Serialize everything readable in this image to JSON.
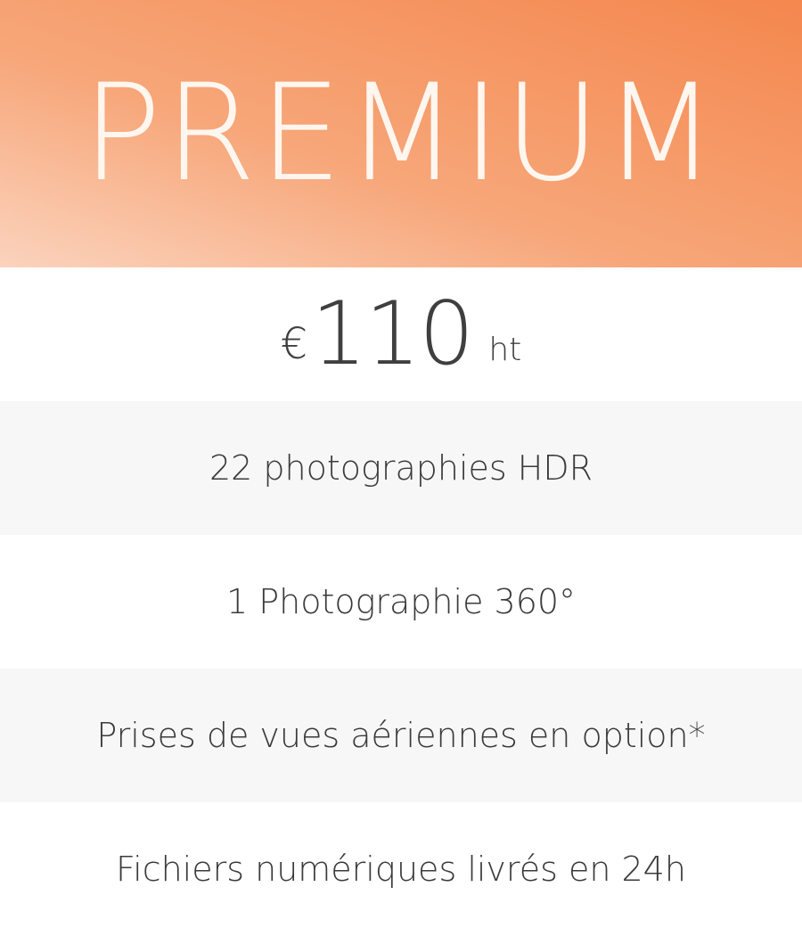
{
  "plan": {
    "title": "PREMIUM",
    "accent_gradient": [
      "#fbd3bd",
      "#f7a77a",
      "#f4874e"
    ],
    "title_color": "#fff7ef"
  },
  "price": {
    "currency": "€",
    "amount": "110",
    "suffix": "ht"
  },
  "features": [
    {
      "label": "22 photographies HDR"
    },
    {
      "label": "1 Photographie 360°"
    },
    {
      "label": "Prises de vues aériennes en option*"
    },
    {
      "label": "Fichiers numériques livrés en 24h"
    }
  ]
}
